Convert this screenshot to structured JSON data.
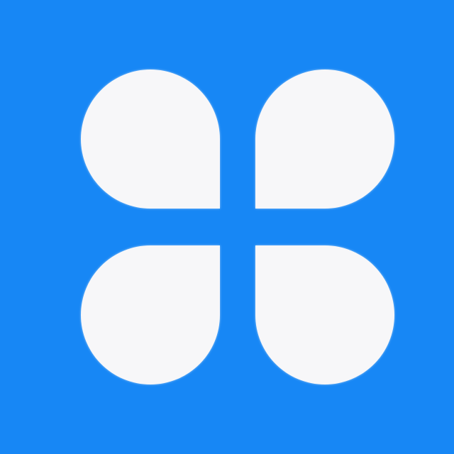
{
  "icon": {
    "name": "clover-app-icon",
    "background_color": "#1787F5",
    "petal_color": "#F7F7F9"
  }
}
